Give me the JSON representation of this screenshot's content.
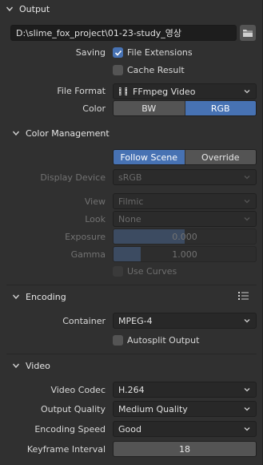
{
  "output": {
    "header": "Output",
    "path": "D:\\slime_fox_project\\01-23-study_영상",
    "saving_label": "Saving",
    "file_extensions": "File Extensions",
    "cache_result": "Cache Result",
    "file_format_label": "File Format",
    "file_format_value": "FFmpeg Video",
    "color_label": "Color",
    "color_options": [
      "BW",
      "RGB"
    ]
  },
  "color_management": {
    "header": "Color Management",
    "mode_options": [
      "Follow Scene",
      "Override"
    ],
    "display_device_label": "Display Device",
    "display_device_value": "sRGB",
    "view_label": "View",
    "view_value": "Filmic",
    "look_label": "Look",
    "look_value": "None",
    "exposure_label": "Exposure",
    "exposure_value": "0.000",
    "gamma_label": "Gamma",
    "gamma_value": "1.000",
    "use_curves": "Use Curves"
  },
  "encoding": {
    "header": "Encoding",
    "container_label": "Container",
    "container_value": "MPEG-4",
    "autosplit": "Autosplit Output"
  },
  "video": {
    "header": "Video",
    "codec_label": "Video Codec",
    "codec_value": "H.264",
    "quality_label": "Output Quality",
    "quality_value": "Medium Quality",
    "speed_label": "Encoding Speed",
    "speed_value": "Good",
    "keyframe_label": "Keyframe Interval",
    "keyframe_value": "18"
  },
  "colors": {
    "accent": "#4772b3",
    "panel_bg": "#303030"
  }
}
